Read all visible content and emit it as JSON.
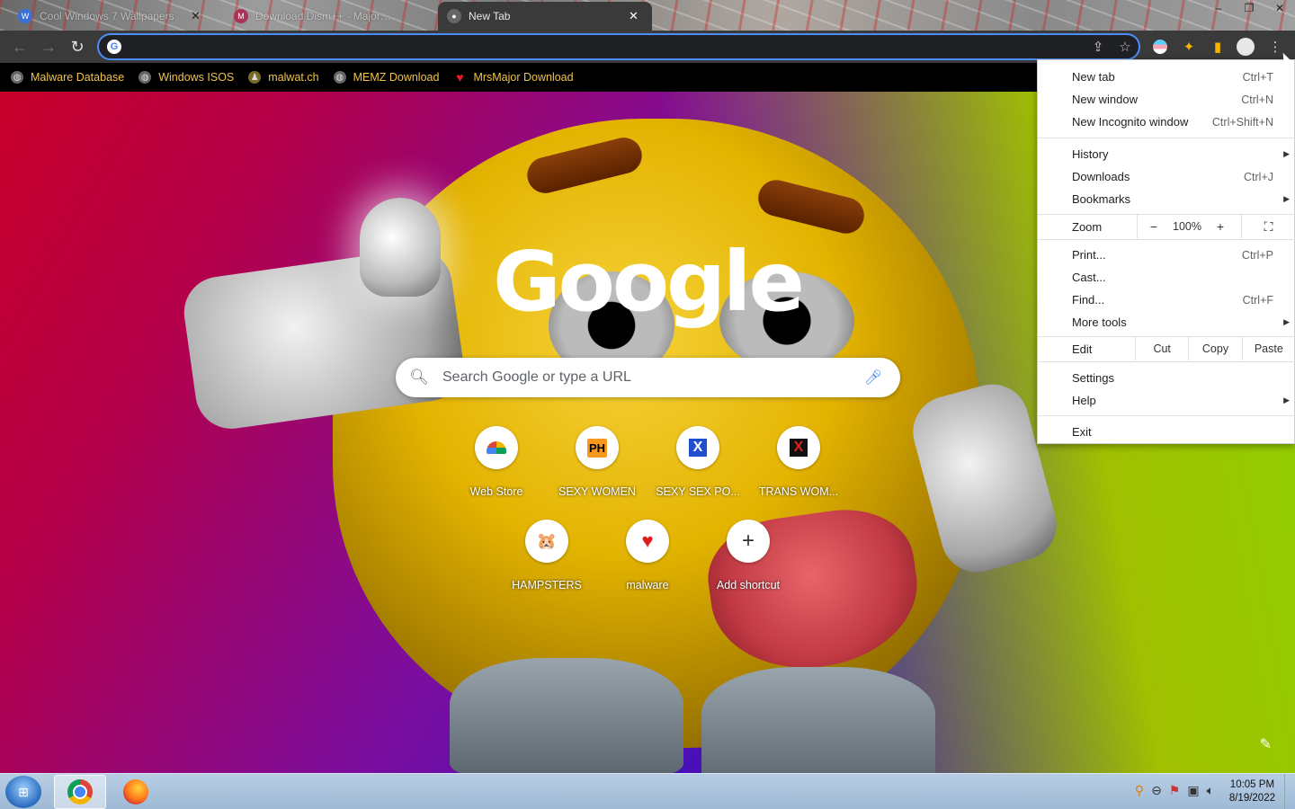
{
  "tabs": [
    {
      "title": "Cool Windows 7 Wallpapers",
      "favicon_icon": "wallpaper-site-icon",
      "active": false
    },
    {
      "title": "Download Dism++ - MajorGeeks",
      "favicon_icon": "majorgeeks-icon",
      "active": false
    },
    {
      "title": "New Tab",
      "favicon_icon": "chrome-newtab-icon",
      "active": true
    }
  ],
  "omnibox": {
    "value": "",
    "placeholder": ""
  },
  "bookmarks": [
    {
      "label": "Malware Database",
      "icon": "globe-icon"
    },
    {
      "label": "Windows ISOS",
      "icon": "globe-icon"
    },
    {
      "label": "malwat.ch",
      "icon": "malwatch-icon"
    },
    {
      "label": "MEMZ Download",
      "icon": "globe-icon"
    },
    {
      "label": "MrsMajor Download",
      "icon": "heart-icon"
    }
  ],
  "ntp": {
    "logo": "Google",
    "search_placeholder": "Search Google or type a URL",
    "shortcuts": [
      {
        "label": "Web Store",
        "glyph": "",
        "icon": "webstore-icon"
      },
      {
        "label": "SEXY WOMEN",
        "glyph": "PH",
        "icon": "ph-icon"
      },
      {
        "label": "SEXY SEX PO...",
        "glyph": "X",
        "icon": "x-blue-icon"
      },
      {
        "label": "TRANS WOM...",
        "glyph": "X",
        "icon": "x-red-icon"
      },
      {
        "label": "HAMPSTERS",
        "glyph": "🐹",
        "icon": "hamster-icon"
      },
      {
        "label": "malware",
        "glyph": "♥",
        "icon": "heart-icon"
      },
      {
        "label": "Add shortcut",
        "glyph": "+",
        "icon": "plus-icon"
      }
    ]
  },
  "menu": {
    "new_tab": {
      "label": "New tab",
      "shortcut": "Ctrl+T"
    },
    "new_window": {
      "label": "New window",
      "shortcut": "Ctrl+N"
    },
    "new_incognito": {
      "label": "New Incognito window",
      "shortcut": "Ctrl+Shift+N"
    },
    "history": {
      "label": "History"
    },
    "downloads": {
      "label": "Downloads",
      "shortcut": "Ctrl+J"
    },
    "bookmarks": {
      "label": "Bookmarks"
    },
    "zoom": {
      "label": "Zoom",
      "minus": "−",
      "value": "100%",
      "plus": "+"
    },
    "print": {
      "label": "Print...",
      "shortcut": "Ctrl+P"
    },
    "cast": {
      "label": "Cast..."
    },
    "find": {
      "label": "Find...",
      "shortcut": "Ctrl+F"
    },
    "more_tools": {
      "label": "More tools"
    },
    "edit": {
      "label": "Edit",
      "cut": "Cut",
      "copy": "Copy",
      "paste": "Paste"
    },
    "settings": {
      "label": "Settings"
    },
    "help": {
      "label": "Help"
    },
    "exit": {
      "label": "Exit"
    }
  },
  "taskbar": {
    "time": "10:05 PM",
    "date": "8/19/2022"
  },
  "colors": {
    "bookmark_text": "#f0c24a",
    "omnibox_focus": "#4c8ef7",
    "toolbar_bg": "#3a3a3a"
  }
}
